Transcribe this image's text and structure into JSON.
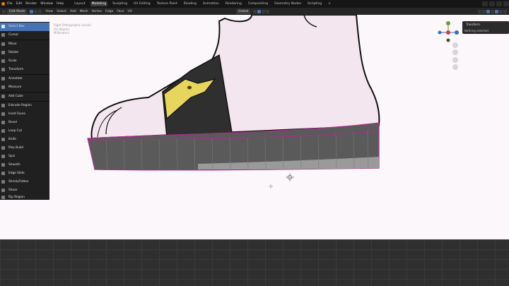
{
  "topbar": {
    "menus": [
      "File",
      "Edit",
      "Render",
      "Window",
      "Help"
    ],
    "workspaces": [
      "Layout",
      "Modeling",
      "Sculpting",
      "UV Editing",
      "Texture Paint",
      "Shading",
      "Animation",
      "Rendering",
      "Compositing",
      "Geometry Nodes",
      "Scripting",
      "+"
    ],
    "active_workspace": "Modeling"
  },
  "header": {
    "mode": "Edit Mode",
    "menus": [
      "View",
      "Select",
      "Add",
      "Mesh",
      "Vertex",
      "Edge",
      "Face",
      "UV"
    ],
    "orientation": "Global"
  },
  "toolbar": {
    "items": [
      "Select Box",
      "Cursor",
      "Move",
      "Rotate",
      "Scale",
      "Transform",
      "Annotate",
      "Measure",
      "Add Cube",
      "Extrude Region",
      "Inset Faces",
      "Bevel",
      "Loop Cut",
      "Knife",
      "Poly Build",
      "Spin",
      "Smooth",
      "Edge Slide",
      "Shrink/Fatten",
      "Shear",
      "Rip Region"
    ],
    "active": "Select Box"
  },
  "viewport": {
    "info_lines": [
      "Right Orthographic (Local)",
      "(0) Objects",
      "Millimeters"
    ]
  },
  "npanel": {
    "title": "Transform",
    "message": "Nothing selected"
  },
  "colors": {
    "accent": "#4772b3",
    "viewport_bg": "#fbf7fa",
    "sock_strap": "#2f2f2f",
    "yellow_patch": "#e8d65c",
    "sole": "#555555",
    "edge_highlight": "#b02a8f"
  }
}
